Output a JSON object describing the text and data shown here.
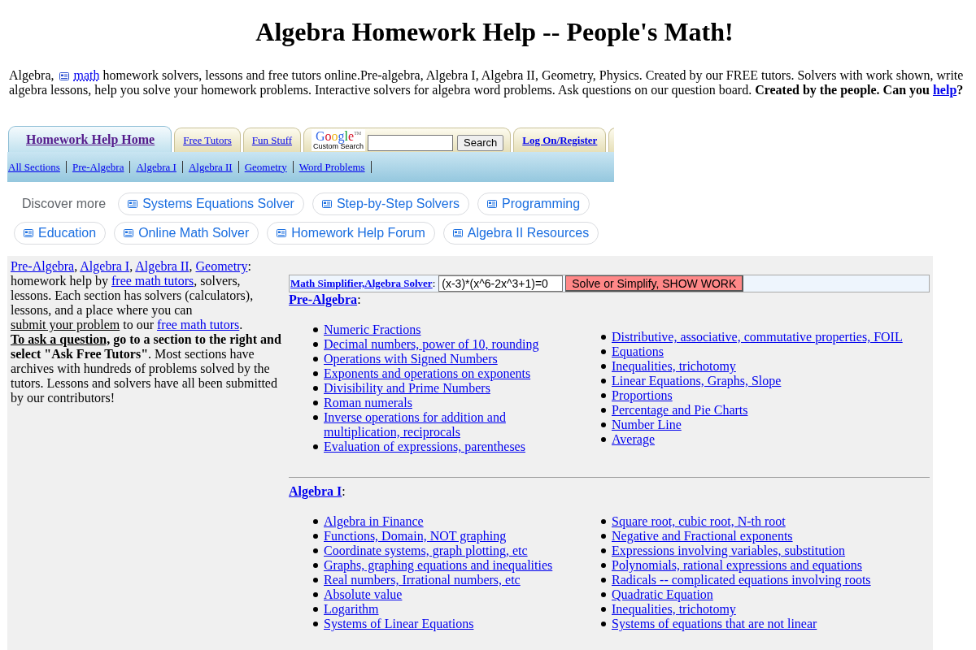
{
  "title": "Algebra Homework Help -- People's Math!",
  "intro": [
    {
      "kind": "text",
      "text": "Algebra, "
    },
    {
      "kind": "icon-link",
      "text": "math"
    },
    {
      "kind": "text",
      "text": " homework solvers, lessons and free tutors online.Pre-algebra, Algebra I, Algebra II, Geometry, Physics. Created by our FREE tutors. Solvers with work shown, write algebra lessons, help you solve your homework problems. Interactive solvers for algebra word problems. Ask questions on our question board. **Created by the people. Can you** "
    },
    {
      "kind": "link-bold",
      "text": "help"
    },
    {
      "kind": "text",
      "text": "**?**"
    }
  ],
  "tab_bar": [
    {
      "kind": "tab",
      "label": "Homework Help Home",
      "selected": true,
      "bold": true
    },
    {
      "kind": "tab",
      "label": "Free Tutors",
      "selected": false,
      "bold": false
    },
    {
      "kind": "tab",
      "label": "Fun Stuff",
      "selected": false,
      "bold": false
    },
    {
      "kind": "search",
      "logo": "Google",
      "logo_mark": "TM",
      "caption": "Custom Search",
      "button": "Search"
    },
    {
      "kind": "tab",
      "label": "Log On/Register",
      "selected": false,
      "bold": true
    },
    {
      "kind": "edge"
    }
  ],
  "section_links": [
    "All Sections",
    "Pre-Algebra",
    "Algebra I",
    "Algebra II",
    "Geometry",
    "Word Problems"
  ],
  "discover": {
    "label": "Discover more",
    "chips": [
      "Systems Equations Solver",
      "Step-by-Step Solvers",
      "Programming",
      "Education",
      "Online Math Solver",
      "Homework Help Forum",
      "Algebra II Resources"
    ]
  },
  "sidebar": [
    {
      "kind": "link",
      "text": "Pre-Algebra"
    },
    {
      "kind": "text",
      "text": ", "
    },
    {
      "kind": "link",
      "text": "Algebra I"
    },
    {
      "kind": "text",
      "text": ", "
    },
    {
      "kind": "link",
      "text": "Algebra II"
    },
    {
      "kind": "text",
      "text": ", "
    },
    {
      "kind": "link",
      "text": "Geometry"
    },
    {
      "kind": "text",
      "text": ": homework help by "
    },
    {
      "kind": "link",
      "text": "free math tutors"
    },
    {
      "kind": "text",
      "text": ", solvers, lessons. Each section has solvers (calculators), lessons, and a place where you can "
    },
    {
      "kind": "underline",
      "text": "submit your problem"
    },
    {
      "kind": "text",
      "text": " to our "
    },
    {
      "kind": "link",
      "text": "free math tutors"
    },
    {
      "kind": "text",
      "text": ". "
    },
    {
      "kind": "underline-bold",
      "text": "To ask a question,"
    },
    {
      "kind": "text",
      "text": " **go to a section to the right and select \"Ask Free Tutors\"**. Most sections have archives with hundreds of problems solved by the tutors. Lessons and solvers have all been submitted by our contributors!"
    }
  ],
  "solver": {
    "link": "Math Simplifier,Algebra Solver",
    "link_suffix": ":",
    "value": "(x-3)*(x^6-2x^3+1)=0",
    "button": "Solve or Simplify, SHOW WORK"
  },
  "sections": [
    {
      "heading": "Pre-Algebra",
      "heading_suffix": ":",
      "columns": [
        [
          "Numeric Fractions",
          "Decimal numbers, power of 10, rounding",
          "Operations with Signed Numbers",
          "Exponents and operations on exponents",
          "Divisibility and Prime Numbers",
          "Roman numerals",
          "Inverse operations for addition and multiplication, reciprocals",
          "Evaluation of expressions, parentheses"
        ],
        [
          "Distributive, associative, commutative properties, FOIL",
          "Equations",
          "Inequalities, trichotomy",
          "Linear Equations, Graphs, Slope",
          "Proportions",
          "Percentage and Pie Charts",
          "Number Line",
          "Average"
        ]
      ]
    },
    {
      "heading": "Algebra I",
      "heading_suffix": ":",
      "columns": [
        [
          "Algebra in Finance",
          "Functions, Domain, NOT graphing",
          "Coordinate systems, graph plotting, etc",
          "Graphs, graphing equations and inequalities",
          "Real numbers, Irrational numbers, etc",
          "Absolute value",
          "Logarithm",
          "Systems of Linear Equations"
        ],
        [
          "Square root, cubic root, N-th root",
          "Negative and Fractional exponents",
          "Expressions involving variables, substitution",
          "Polynomials, rational expressions and equations",
          "Radicals -- complicated equations involving roots",
          "Quadratic Equation",
          "Inequalities, trichotomy",
          "Systems of equations that are not linear"
        ]
      ]
    }
  ]
}
